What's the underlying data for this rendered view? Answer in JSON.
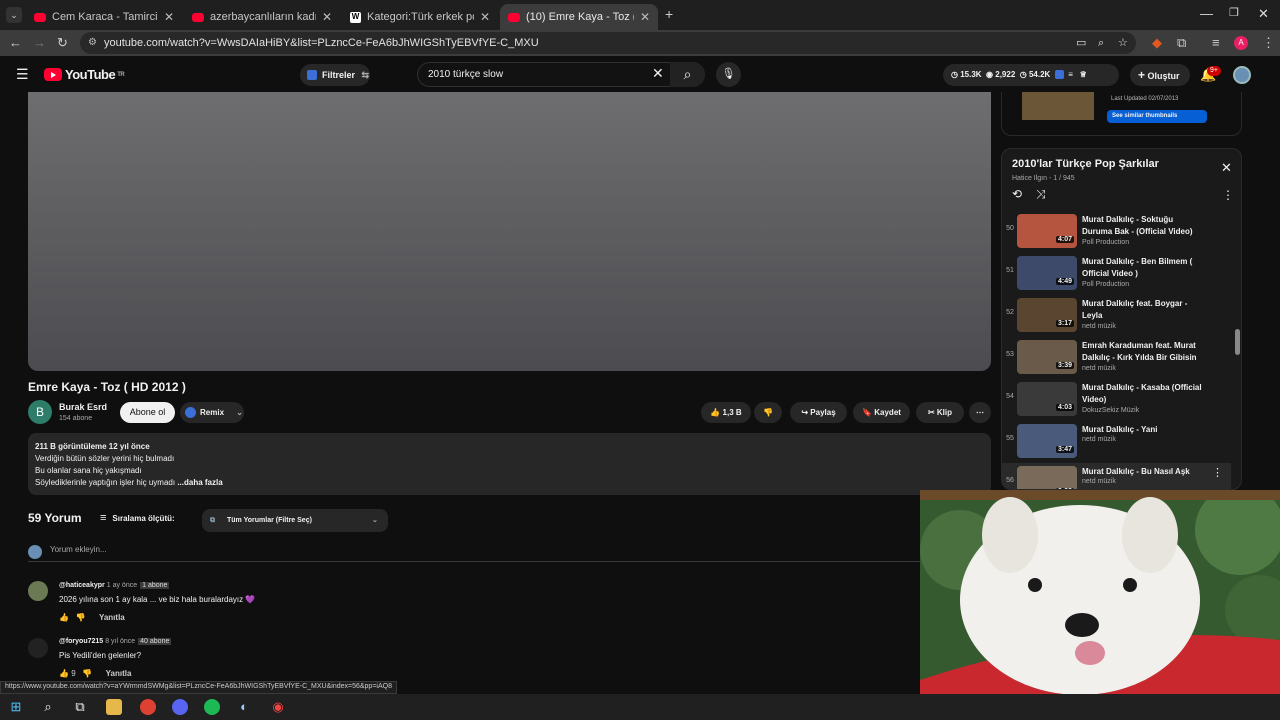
{
  "browser": {
    "tabs": [
      {
        "title": "Cem Karaca - Tamirci Çırağı (Of",
        "icon": "youtube-icon"
      },
      {
        "title": "azerbaycanlıların kadın ile düet",
        "icon": "youtube-icon"
      },
      {
        "title": "Kategori:Türk erkek pop şarkıcı",
        "icon": "wikipedia-icon"
      },
      {
        "title": "(10) Emre Kaya - Toz ( HD 2012",
        "icon": "youtube-icon"
      }
    ],
    "url": "youtube.com/watch?v=WwsDAIaHiBY&list=PLzncCe-FeA6bJhWIGShTyEBVfYE-C_MXU",
    "profile_letter": "A",
    "status_url": "https://www.youtube.com/watch?v=aYWrmmdSWMg&list=PLzncCe-FeA6bJhWIGShTyEBVfYE-C_MXU&index=56&pp=iAQ8"
  },
  "yt_header": {
    "logo_text": "YouTube",
    "region": "TR",
    "filters_label": "Filtreler",
    "search_value": "2010 türkçe slow",
    "stat_views": "15.3K",
    "stat_watch": "2,922",
    "stat_likes": "54.2K",
    "create_label": "Oluştur",
    "notif_badge": "9+"
  },
  "video": {
    "title": "Emre Kaya - Toz ( HD 2012 )",
    "channel_initial": "B",
    "channel": "Burak Esrd",
    "subscribers": "154 abone",
    "subscribe_label": "Abone ol",
    "remix_label": "Remix",
    "likes": "1,3 B",
    "share_label": "Paylaş",
    "save_label": "Kaydet",
    "clip_label": "Klip"
  },
  "description": {
    "meta": "211 B görüntüleme  12 yıl önce",
    "lines": [
      "Verdiğin bütün sözler yerini hiç bulmadı",
      "Bu olanlar sana hiç yakışmadı",
      "Söylediklerinle yaptığın işler hiç uymadı"
    ],
    "more": "...daha fazla"
  },
  "comments": {
    "count": "59 Yorum",
    "sort_label": "Sıralama ölçütü:",
    "filter_label": "Tüm Yorumlar (Filtre Seç)",
    "add_placeholder": "Yorum ekleyin...",
    "items": [
      {
        "user": "@haticeakypr",
        "time": "1 ay önce",
        "badge": "1 abone",
        "text": "2026 yılına son 1 ay kala ... ve biz hala buralardayız 💜",
        "likes": "",
        "reply": "Yanıtla"
      },
      {
        "user": "@foryou7215",
        "time": "8 yıl önce",
        "badge": "40 abone",
        "text": "Pis Yedili'den gelenler?",
        "likes": "9",
        "reply": "Yanıtla"
      }
    ]
  },
  "thumb_panel": {
    "updated": "Last Updated 02/07/2013",
    "similar_label": "See similar thumbnails"
  },
  "playlist": {
    "title": "2010'lar Türkçe Pop Şarkılar",
    "owner": "Hatice Ilgın - 1 / 945",
    "items": [
      {
        "idx": "50",
        "title": "Murat Dalkılıç - Soktuğu Duruma Bak - (Official Video)",
        "channel": "Poll Production",
        "duration": "4:07"
      },
      {
        "idx": "51",
        "title": "Murat Dalkılıç - Ben Bilmem ( Official Video )",
        "channel": "Poll Production",
        "duration": "4:49"
      },
      {
        "idx": "52",
        "title": "Murat Dalkılıç feat. Boygar - Leyla",
        "channel": "netd müzik",
        "duration": "3:17"
      },
      {
        "idx": "53",
        "title": "Emrah Karaduman feat. Murat Dalkılıç - Kırk Yılda Bir Gibisin",
        "channel": "netd müzik",
        "duration": "3:39"
      },
      {
        "idx": "54",
        "title": "Murat Dalkılıç - Kasaba (Official Video)",
        "channel": "DokuzSekiz Müzik",
        "duration": "4:03"
      },
      {
        "idx": "55",
        "title": "Murat Dalkılıç - Yani",
        "channel": "netd müzik",
        "duration": "3:47"
      },
      {
        "idx": "56",
        "title": "Murat Dalkılıç - Bu Nasıl Aşk",
        "channel": "netd müzik",
        "duration": "3:33"
      }
    ]
  },
  "colors": {
    "accent": "#ff0033",
    "bg": "#0f0f0f",
    "link": "#3ea6ff",
    "similar_btn": "#065fd4"
  }
}
